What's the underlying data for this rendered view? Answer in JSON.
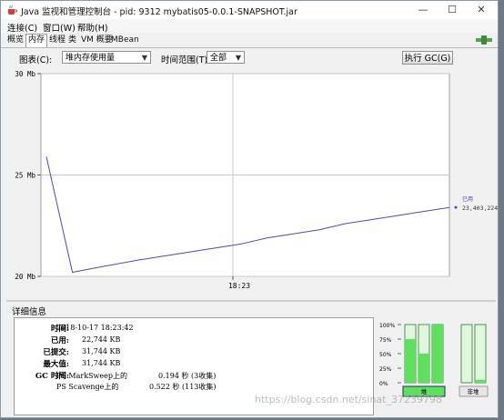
{
  "window": {
    "title": "Java 监视和管理控制台 - pid: 9312 mybatis05-0.0.1-SNAPSHOT.jar",
    "minimize": "—",
    "maximize": "☐",
    "close": "✕"
  },
  "menu": {
    "items": [
      "连接(C)",
      "窗口(W)",
      "帮助(H)"
    ]
  },
  "tabs": {
    "items": [
      "概览",
      "内存",
      "线程",
      "类",
      "VM 概要",
      "MBean"
    ],
    "active": 1
  },
  "toolbar": {
    "chart_label": "图表(C):",
    "chart_value": "堆内存使用量",
    "range_label": "时间范围(T):",
    "range_value": "全部",
    "gc_button": "执行 GC(G)"
  },
  "chart_data": {
    "type": "line",
    "ylim": [
      20,
      30
    ],
    "yticks": [
      {
        "v": 20,
        "label": "20 Mb"
      },
      {
        "v": 25,
        "label": "25 Mb"
      },
      {
        "v": 30,
        "label": "30 Mb"
      }
    ],
    "xtick": "18:23",
    "series": [
      {
        "name": "已用",
        "color": "#4a4ab8",
        "points": [
          [
            0,
            25.9
          ],
          [
            0.08,
            20.2
          ],
          [
            0.18,
            20.5
          ],
          [
            0.28,
            20.8
          ],
          [
            0.36,
            21.0
          ],
          [
            0.44,
            21.2
          ],
          [
            0.52,
            21.4
          ],
          [
            0.6,
            21.6
          ],
          [
            0.68,
            21.9
          ],
          [
            0.76,
            22.1
          ],
          [
            0.84,
            22.3
          ],
          [
            0.92,
            22.6
          ],
          [
            1.0,
            22.8
          ],
          [
            1.08,
            23.0
          ],
          [
            1.16,
            23.2
          ],
          [
            1.24,
            23.4
          ]
        ]
      }
    ],
    "current_value": "23,403,224",
    "colors": {
      "grid": "#c8c8c8",
      "plot_bg": "#ffffff"
    }
  },
  "details": {
    "header": "详细信息",
    "time_label": "时间:",
    "time_value": "2018-10-17 18:23:42",
    "used_label": "已用:",
    "used_value": "22,744 KB",
    "committed_label": "已提交:",
    "committed_value": "31,744 KB",
    "max_label": "最大值:",
    "max_value": "31,744 KB",
    "gc_label": "GC 时间:",
    "gc": [
      {
        "name": "PS MarkSweep上的",
        "value": "0.194 秒 (3收集)"
      },
      {
        "name": "PS Scavenge上的",
        "value": "0.522 秒 (113收集)"
      }
    ]
  },
  "pools": {
    "ticks": [
      "100%",
      "75%",
      "50%",
      "25%",
      "0%"
    ],
    "heap_label": "堆",
    "nonheap_label": "非堆",
    "heap_fills": [
      0.75,
      0.5,
      1.0
    ],
    "nonheap_fills": [
      0.0,
      0.05
    ],
    "colors": {
      "fill": "#5ee05e",
      "light": "#dff7df",
      "border": "#2b7a2b"
    }
  },
  "watermark": "https://blog.csdn.net/sinat_37239798"
}
